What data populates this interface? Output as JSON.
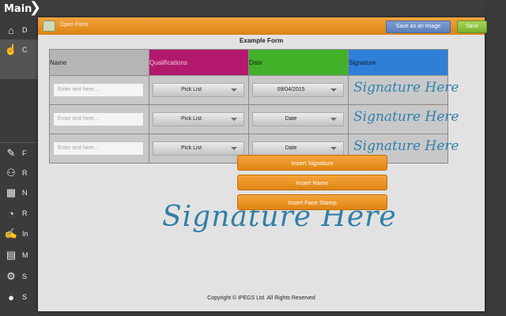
{
  "app": {
    "title": "Main",
    "back_glyph": "❯"
  },
  "sidebar": {
    "items": [
      {
        "icon": "home-icon",
        "glyph": "⌂",
        "letter": "D"
      },
      {
        "icon": "thumbs-up-icon",
        "glyph": "☝",
        "letter": "C"
      },
      {
        "icon": "pencil-icon",
        "glyph": "✎",
        "letter": "F"
      },
      {
        "icon": "users-icon",
        "glyph": "⚇",
        "letter": "R"
      },
      {
        "icon": "calendar-icon",
        "glyph": "▦",
        "letter": "N"
      },
      {
        "icon": "pie-chart-icon",
        "glyph": "◔",
        "letter": "R"
      },
      {
        "icon": "edit-icon",
        "glyph": "✍",
        "letter": "In"
      },
      {
        "icon": "inbox-icon",
        "glyph": "▤",
        "letter": "M"
      },
      {
        "icon": "gear-icon",
        "glyph": "⚙",
        "letter": "S"
      },
      {
        "icon": "chat-bubble-icon",
        "glyph": "●",
        "letter": "S"
      }
    ]
  },
  "modal": {
    "title": "Open Form",
    "save_image_label": "Save as an Image",
    "save_label": "Save",
    "form_title": "Example Form",
    "columns": [
      "Name",
      "Qualifications",
      "Date",
      "Signature"
    ],
    "rows": [
      {
        "name_placeholder": "Enter text here...",
        "qualification": "Pick List",
        "date": "09/04/2015",
        "signature": "Signature Here"
      },
      {
        "name_placeholder": "Enter text here...",
        "qualification": "Pick List",
        "date": "Date",
        "signature": "Signature Here"
      },
      {
        "name_placeholder": "Enter text here...",
        "qualification": "Pick List",
        "date": "Date",
        "signature": "Signature Here"
      }
    ],
    "menu": [
      "Insert Signature",
      "Insert Name",
      "Insert Face Stamp"
    ],
    "big_signature": "Signature Here",
    "copyright": "Copyright © iPEGS Ltd. All Rights Reserved"
  },
  "colors": {
    "accent_orange": "#e8901f",
    "qualifications_header": "#b2196c",
    "date_header": "#43b02a",
    "signature_header": "#2e7fd8",
    "save_image_button": "#6b8fca",
    "save_button": "#8cc13f"
  }
}
